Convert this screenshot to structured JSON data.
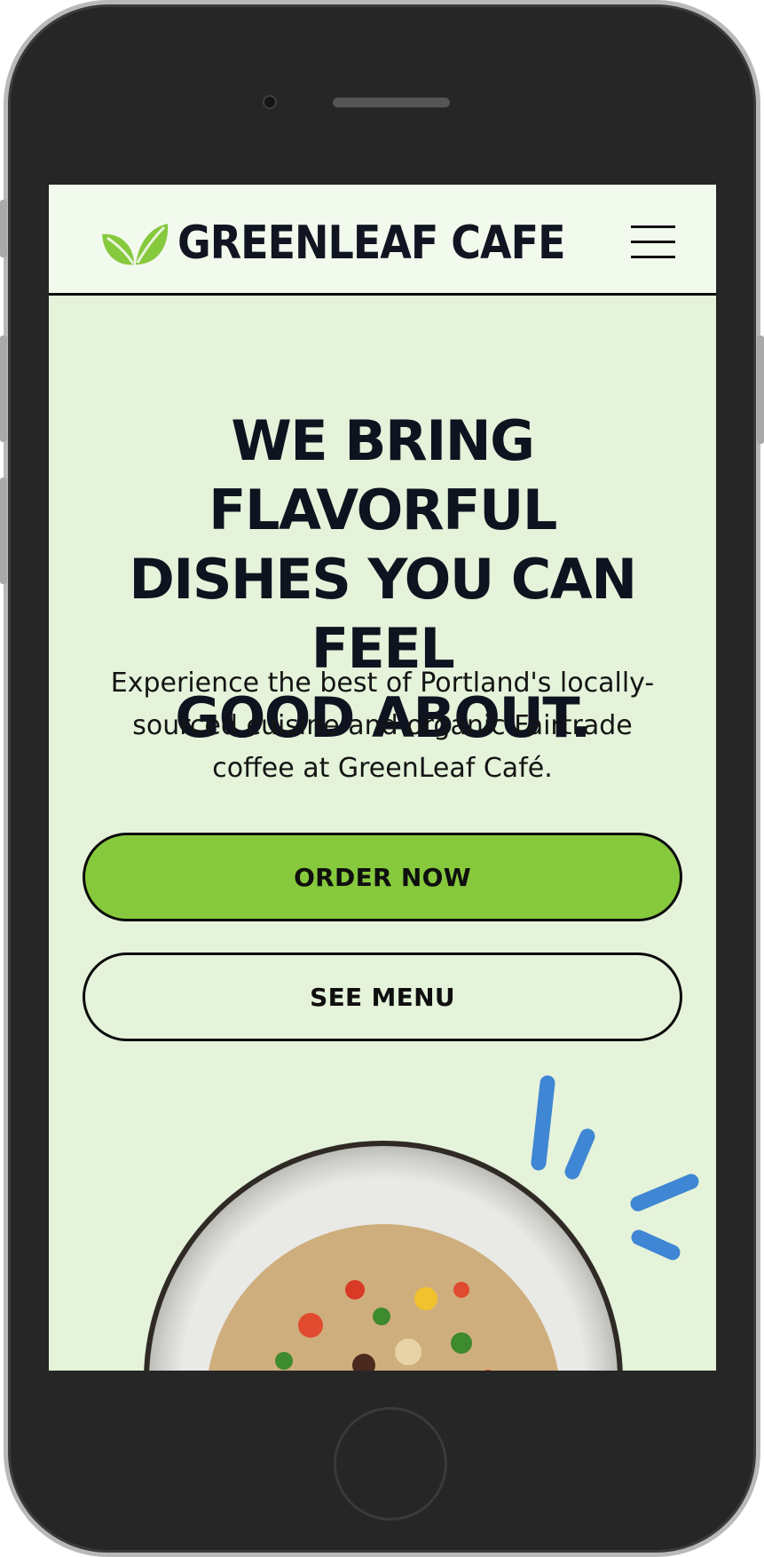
{
  "brand": {
    "name": "GREENLEAF CAFE"
  },
  "hero": {
    "headline_lines": [
      "WE BRING FLAVORFUL",
      "DISHES YOU CAN FEEL",
      "GOOD ABOUT."
    ],
    "subtitle_lines": [
      "Experience the best of Portland's locally-",
      "sourced cuisine and organic Fairtrade",
      "coffee at GreenLeaf Café."
    ]
  },
  "buttons": {
    "order": "ORDER NOW",
    "menu": "SEE MENU"
  },
  "icons": {
    "logo": "leaf-icon",
    "nav": "hamburger-menu-icon",
    "decoration": "accent-dashes",
    "hero_image": "grain-salad-bowl"
  },
  "colors": {
    "header_bg": "#f2f9ed",
    "page_bg": "#e5f3da",
    "accent_green": "#86c93d",
    "text_dark": "#0f1320",
    "accent_blue": "#3f86d4"
  }
}
